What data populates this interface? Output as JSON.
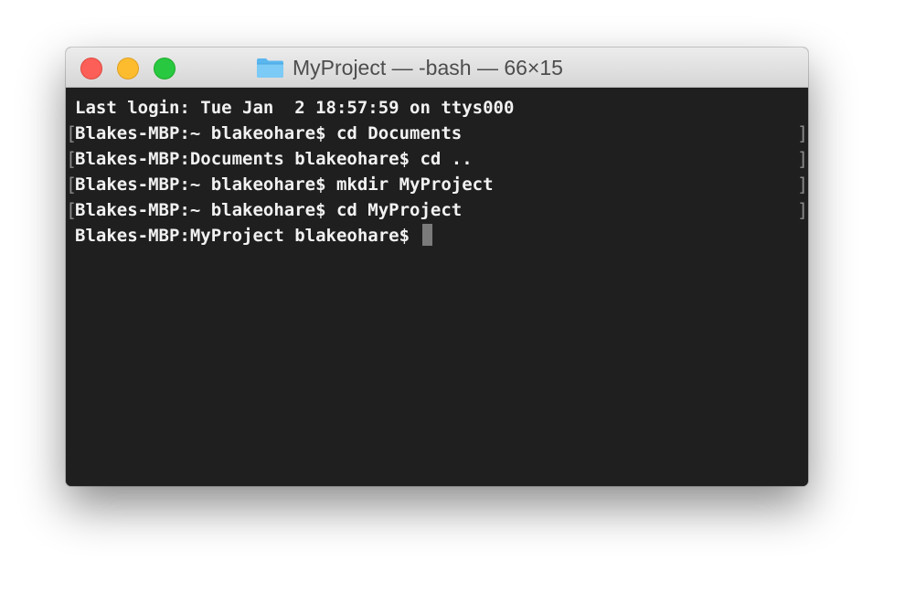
{
  "window": {
    "title": "MyProject — -bash — 66×15",
    "folder_icon": "folder-icon",
    "accent_colors": {
      "close": "#fc5f57",
      "minimize": "#fdbc2e",
      "zoom": "#28c840",
      "folder": "#5ab6ef"
    }
  },
  "terminal": {
    "background": "#1f1f1f",
    "foreground": "#f2f2f2",
    "lines": [
      "Last login: Tue Jan  2 18:57:59 on ttys000",
      "Blakes-MBP:~ blakeohare$ cd Documents",
      "Blakes-MBP:Documents blakeohare$ cd ..",
      "Blakes-MBP:~ blakeohare$ mkdir MyProject",
      "Blakes-MBP:~ blakeohare$ cd MyProject",
      "Blakes-MBP:MyProject blakeohare$ "
    ],
    "mark_bracket_left": "[",
    "mark_bracket_right": "]"
  }
}
